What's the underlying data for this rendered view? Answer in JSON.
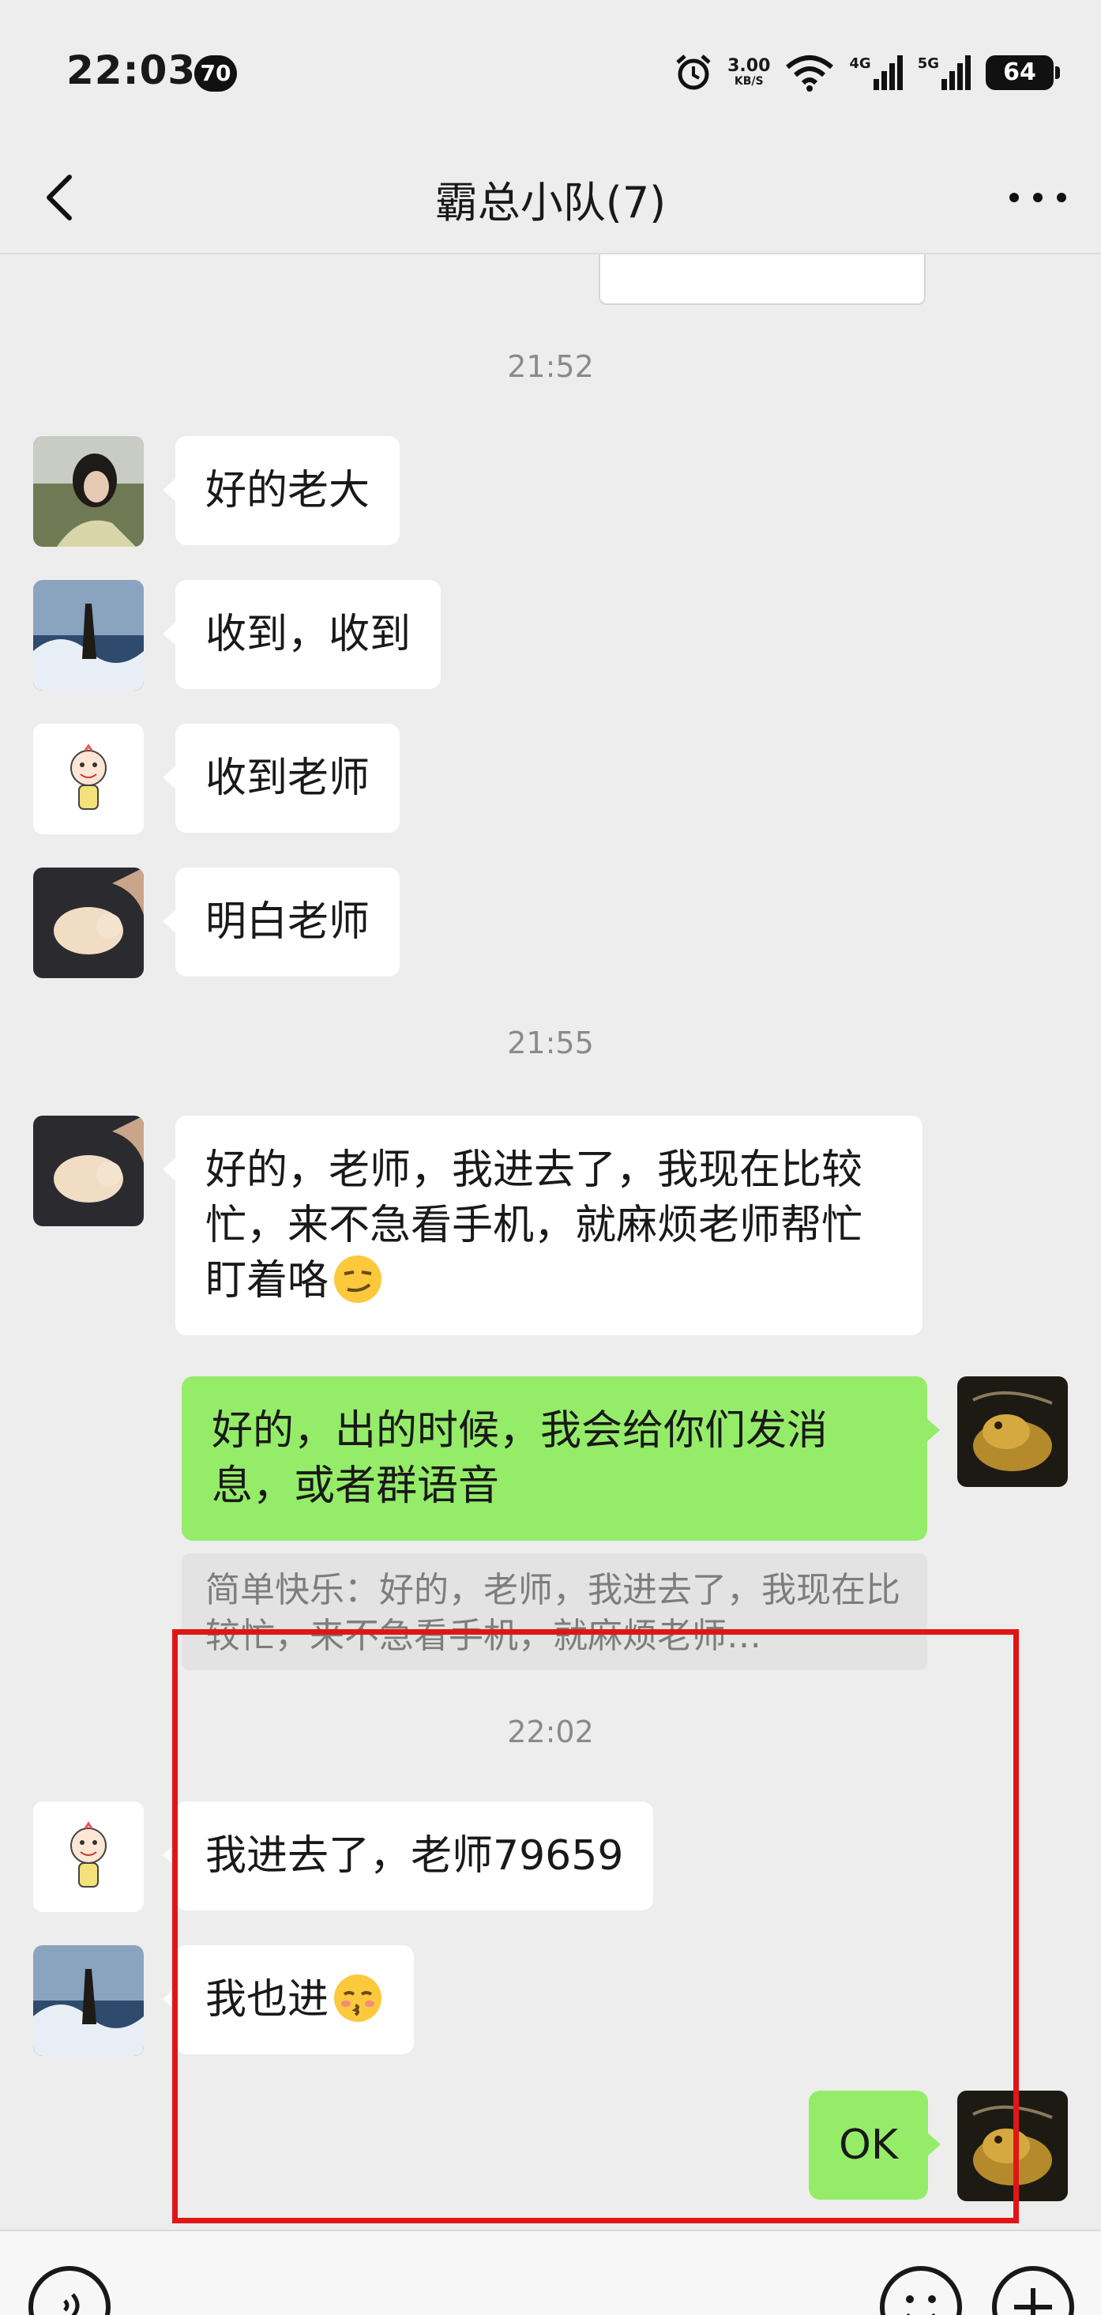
{
  "status_bar": {
    "time": "22:03",
    "notification_count": "70",
    "net_speed": "3.00",
    "net_unit": "KB/S",
    "signal1_label": "4G",
    "signal2_label": "5G",
    "battery": "64"
  },
  "header": {
    "title": "霸总小队(7)"
  },
  "messages": {
    "t1": "21:52",
    "m1": "好的老大",
    "m2": "收到，收到",
    "m3": "收到老师",
    "m4": "明白老师",
    "t2": "21:55",
    "m5": "好的，老师，我进去了，我现在比较忙，来不急看手机，就麻烦老师帮忙盯着咯",
    "m6": "好的，出的时候，我会给你们发消息，或者群语音",
    "quote": "简单快乐：好的，老师，我进去了，我现在比较忙，来不急看手机，就麻烦老师…",
    "t3": "22:02",
    "m7": "我进去了，老师79659",
    "m8": "我也进",
    "m9": "OK"
  },
  "colors": {
    "background": "#ededed",
    "incoming_bubble": "#ffffff",
    "outgoing_bubble": "#95ec69",
    "highlight_box": "#e01616"
  },
  "icons": [
    "back-arrow-icon",
    "more-dots-icon",
    "alarm-icon",
    "wifi-icon",
    "signal-icon",
    "battery-icon",
    "voice-icon",
    "emoji-icon",
    "plus-icon",
    "smirk-emoji-icon",
    "kiss-emoji-icon"
  ]
}
